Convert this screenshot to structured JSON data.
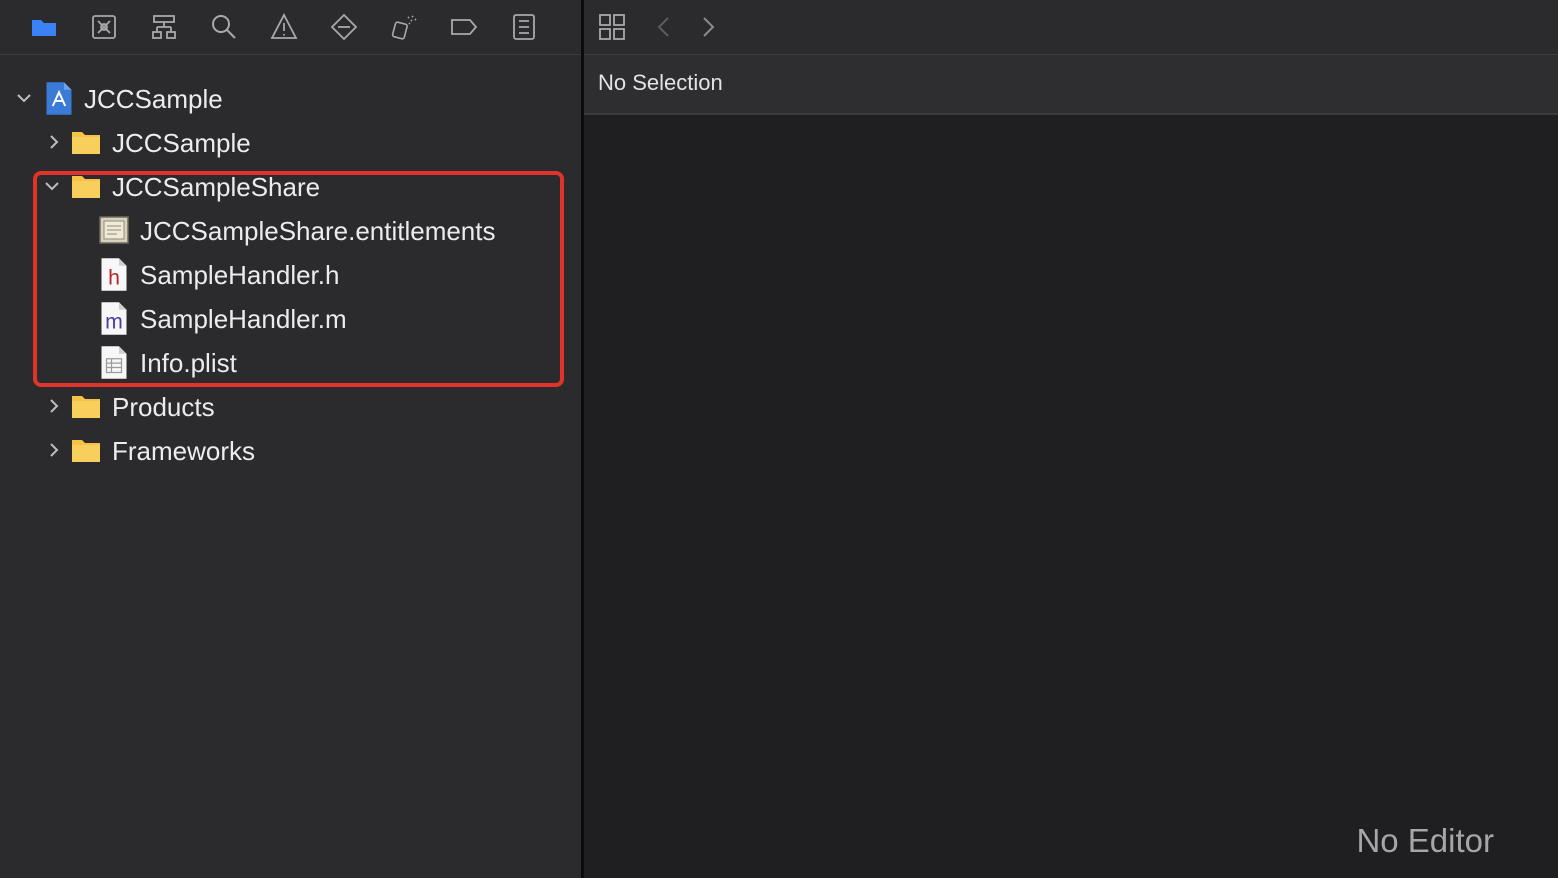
{
  "navigator": {
    "toolbar_icons": [
      "folder-icon",
      "source-control-icon",
      "hierarchy-icon",
      "search-icon",
      "warning-icon",
      "test-diamond-icon",
      "debug-spray-icon",
      "breakpoint-tag-icon",
      "report-list-icon"
    ],
    "tree": {
      "project": {
        "label": "JCCSample",
        "expanded": true
      },
      "items": [
        {
          "label": "JCCSample",
          "kind": "folder",
          "expanded": false
        },
        {
          "label": "JCCSampleShare",
          "kind": "folder",
          "expanded": true,
          "children": [
            {
              "label": "JCCSampleShare.entitlements",
              "kind": "entitlements"
            },
            {
              "label": "SampleHandler.h",
              "kind": "header",
              "glyph": "h"
            },
            {
              "label": "SampleHandler.m",
              "kind": "implementation",
              "glyph": "m"
            },
            {
              "label": "Info.plist",
              "kind": "plist"
            }
          ]
        },
        {
          "label": "Products",
          "kind": "folder",
          "expanded": false
        },
        {
          "label": "Frameworks",
          "kind": "folder",
          "expanded": false
        }
      ]
    }
  },
  "editor": {
    "toolbar_icons": [
      "grid-icon",
      "back-chevron-icon",
      "forward-chevron-icon"
    ],
    "jump_bar": {
      "label": "No Selection"
    },
    "placeholder": "No Editor"
  },
  "colors": {
    "accent": "#3b82f6",
    "folder": "#f5c146",
    "highlight": "#e0332b"
  }
}
